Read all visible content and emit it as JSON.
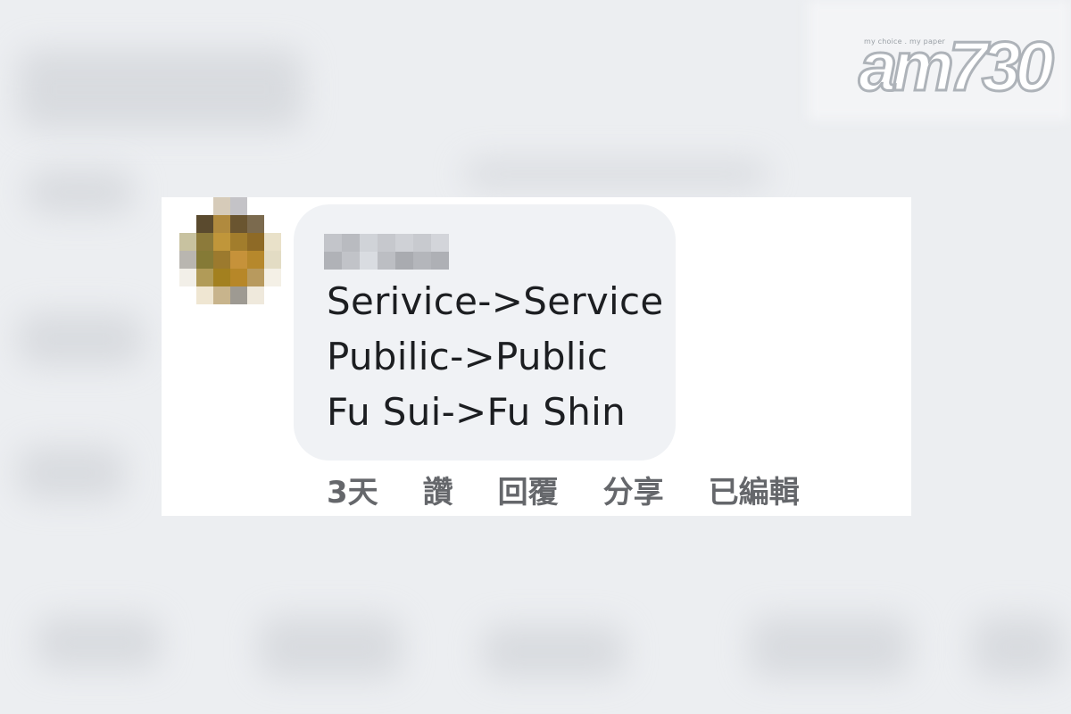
{
  "watermark": {
    "tagline": "my choice . my paper",
    "logo_text": "am730"
  },
  "comment": {
    "author_name": "",
    "lines": [
      "Serivice->Service",
      "Pubilic->Public",
      "Fu Sui->Fu Shin"
    ],
    "timestamp": "3天",
    "like_label": "讚",
    "reply_label": "回覆",
    "share_label": "分享",
    "edited_label": "已編輯"
  }
}
